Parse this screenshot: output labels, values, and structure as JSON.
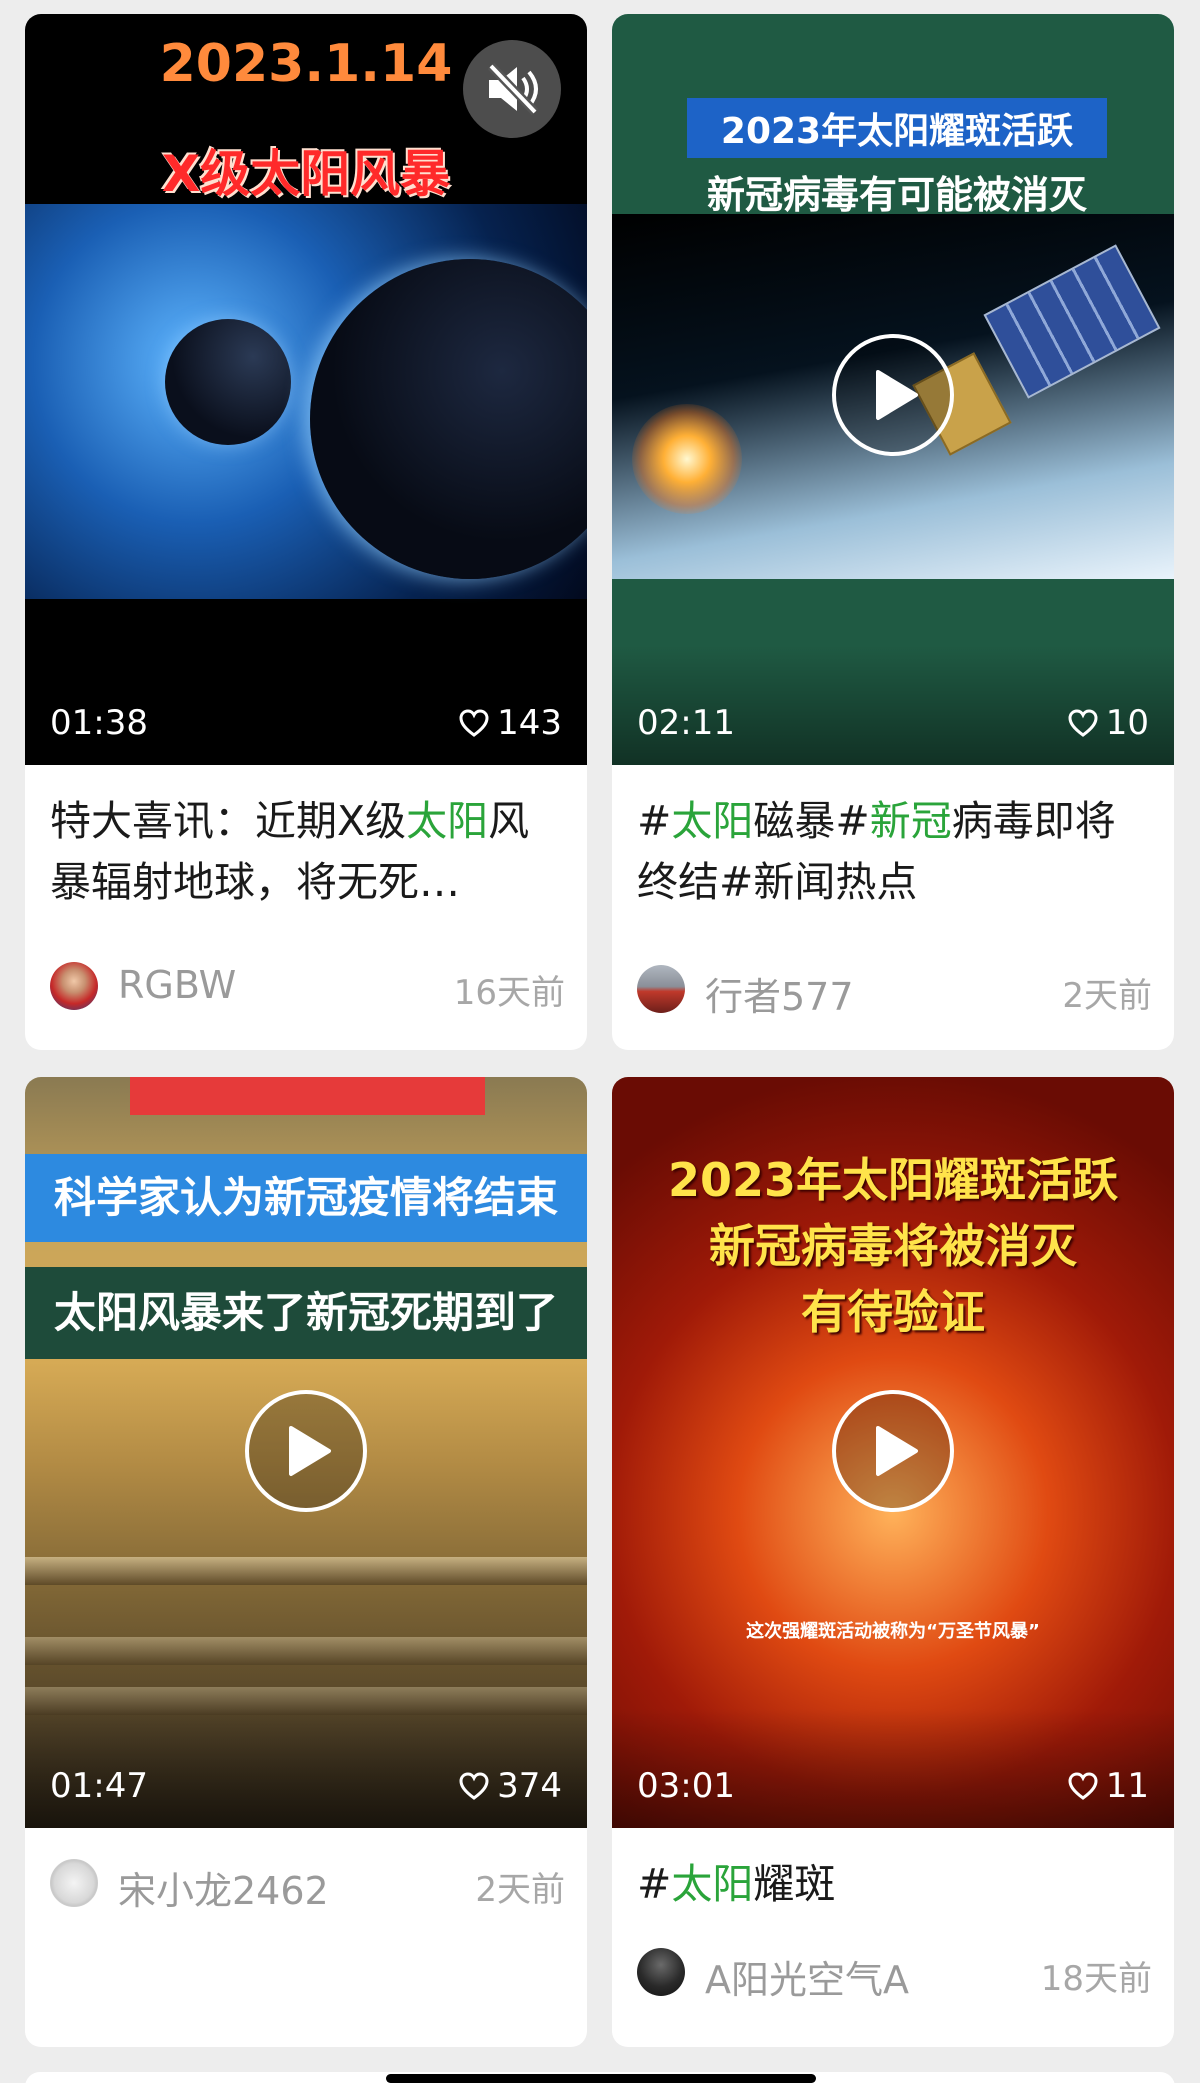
{
  "cards": [
    {
      "thumb_date": "2023.1.14",
      "thumb_title": "X级太阳风暴",
      "duration": "01:38",
      "likes": "143",
      "title_parts": [
        "特大喜讯：近期X级",
        "太阳",
        "风暴辐射地球，将无死…"
      ],
      "author": "RGBW",
      "time": "16天前"
    },
    {
      "thumb_line1": "2023年太阳耀斑活跃",
      "thumb_line2": "新冠病毒有可能被消灭",
      "duration": "02:11",
      "likes": "10",
      "title_parts": [
        "#",
        "太阳",
        "磁暴#",
        "新冠",
        "病毒即将终结#新闻热点"
      ],
      "author": "行者577",
      "time": "2天前"
    },
    {
      "thumb_line1": "科学家认为新冠疫情将结束",
      "thumb_line2": "太阳风暴来了新冠死期到了",
      "duration": "01:47",
      "likes": "374",
      "author": "宋小龙2462",
      "time": "2天前"
    },
    {
      "thumb_line1": "2023年太阳耀斑活跃",
      "thumb_line2": "新冠病毒将被消灭",
      "thumb_line3": "有待验证",
      "thumb_caption": "这次强耀斑活动被称为“万圣节风暴”",
      "duration": "03:01",
      "likes": "11",
      "title_parts": [
        "#",
        "太阳",
        "耀斑"
      ],
      "author": "A阳光空气A",
      "time": "18天前"
    }
  ],
  "icons": {
    "mute": "speaker-muted-icon",
    "play": "play-icon",
    "like": "heart-outline-icon"
  },
  "colors": {
    "highlight": "#2aa43a",
    "background": "#ededed"
  }
}
